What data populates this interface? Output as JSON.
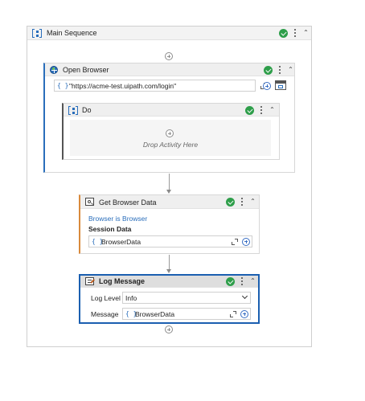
{
  "main_sequence": {
    "title": "Main Sequence"
  },
  "open_browser": {
    "title": "Open Browser",
    "url": "\"https://acme-test.uipath.com/login\""
  },
  "do_block": {
    "title": "Do",
    "drop_text": "Drop Activity Here"
  },
  "get_browser_data": {
    "title": "Get Browser Data",
    "link": "Browser is Browser",
    "session_label": "Session Data",
    "session_value": "BrowserData"
  },
  "log_message": {
    "title": "Log Message",
    "level_label": "Log Level",
    "level_value": "Info",
    "message_label": "Message",
    "message_value": "BrowserData"
  },
  "icons": {
    "status": "check-circle-icon",
    "menu": "more-vertical-icon",
    "collapse": "chevron-double-up-icon",
    "expression": "braces-icon",
    "expand": "expand-icon",
    "add": "add-circle-icon"
  },
  "colors": {
    "accent_blue": "#2a6ebb",
    "success_green": "#2e9e4a",
    "selected_border": "#1b5fb0",
    "header_bg": "#f0f0f0"
  }
}
